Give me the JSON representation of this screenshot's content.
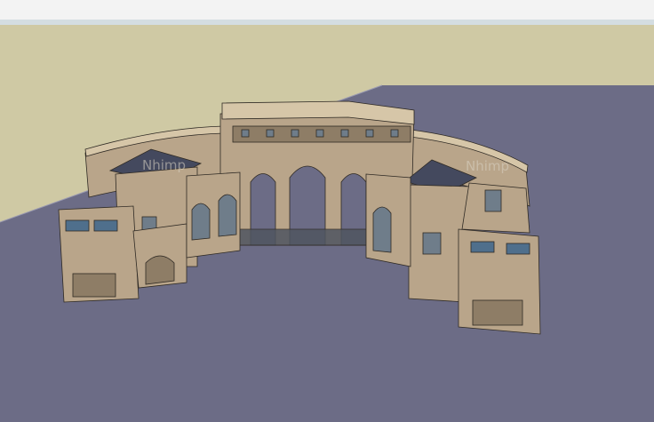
{
  "viewport": {
    "sky_color": "#f3f3f3",
    "horizon_band_color": "#d4dde1",
    "ground_left_color": "#cfc9a4",
    "ground_plane_color": "#6c6c86",
    "ground_edge_color": "#9a9ab0"
  },
  "model": {
    "facade_color": "#b9a58a",
    "facade_shadow_color": "#8e7d66",
    "cornice_color": "#d6c6a8",
    "roof_color": "#44495e",
    "base_color": "#4f5560",
    "window_color": "#6f7d8a",
    "awning_color": "#4f6f8c"
  },
  "watermarks": [
    "Nhimp",
    "Nhimp"
  ]
}
